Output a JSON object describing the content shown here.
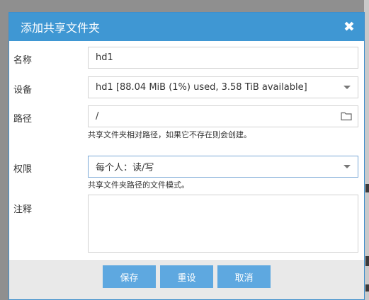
{
  "dialog": {
    "title": "添加共享文件夹",
    "close_icon": "close-icon"
  },
  "form": {
    "name": {
      "label": "名称",
      "value": "hd1"
    },
    "device": {
      "label": "设备",
      "value": "hd1 [88.04 MiB (1%) used, 3.58 TiB available]"
    },
    "path": {
      "label": "路径",
      "value": "/",
      "hint": "共享文件夹相对路径，如果它不存在则会创建。",
      "icon": "folder-icon"
    },
    "permissions": {
      "label": "权限",
      "value": "每个人：读/写",
      "hint": "共享文件夹路径的文件模式。"
    },
    "comment": {
      "label": "注释",
      "value": ""
    }
  },
  "buttons": {
    "save": "保存",
    "reset": "重设",
    "cancel": "取消"
  },
  "colors": {
    "titlebar": "#3f97d3",
    "button": "#5ea8e0",
    "footer": "#e9e9e9"
  }
}
